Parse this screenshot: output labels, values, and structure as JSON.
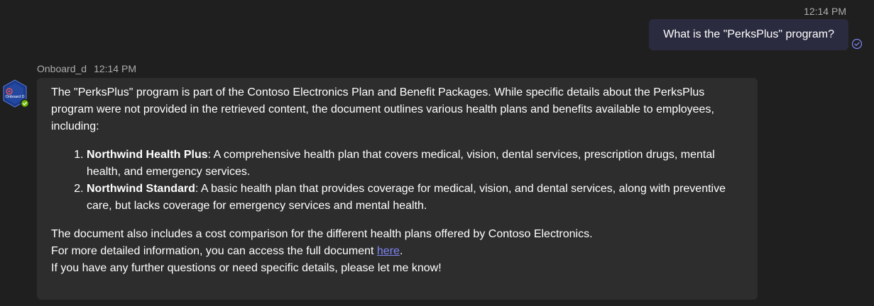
{
  "user_message": {
    "time": "12:14 PM",
    "text": "What is the \"PerksPlus\" program?"
  },
  "bot_message": {
    "sender": "Onboard_d",
    "time": "12:14 PM",
    "avatar_label": "Onboard D",
    "intro": "The \"PerksPlus\" program is part of the Contoso Electronics Plan and Benefit Packages. While specific details about the PerksPlus program were not provided in the retrieved content, the document outlines various health plans and benefits available to employees, including:",
    "plans": [
      {
        "name": "Northwind Health Plus",
        "description": ": A comprehensive health plan that covers medical, vision, dental services, prescription drugs, mental health, and emergency services."
      },
      {
        "name": "Northwind Standard",
        "description": ": A basic health plan that provides coverage for medical, vision, and dental services, along with preventive care, but lacks coverage for emergency services and mental health."
      }
    ],
    "outro_line1": "The document also includes a cost comparison for the different health plans offered by Contoso Electronics.",
    "outro_line2_prefix": "For more detailed information, you can access the full document ",
    "link_text": "here",
    "outro_line2_suffix": ".",
    "outro_line3": "If you have any further questions or need specific details, please let me know!"
  },
  "colors": {
    "background": "#1f1f1f",
    "user_bubble": "#2b2b40",
    "bot_bubble": "#2d2d2d",
    "link": "#7f85f5",
    "meta_text": "#adadad",
    "presence_available": "#6bb700"
  },
  "icons": {
    "read_receipt": "check-circle-icon",
    "presence": "presence-available-icon"
  }
}
